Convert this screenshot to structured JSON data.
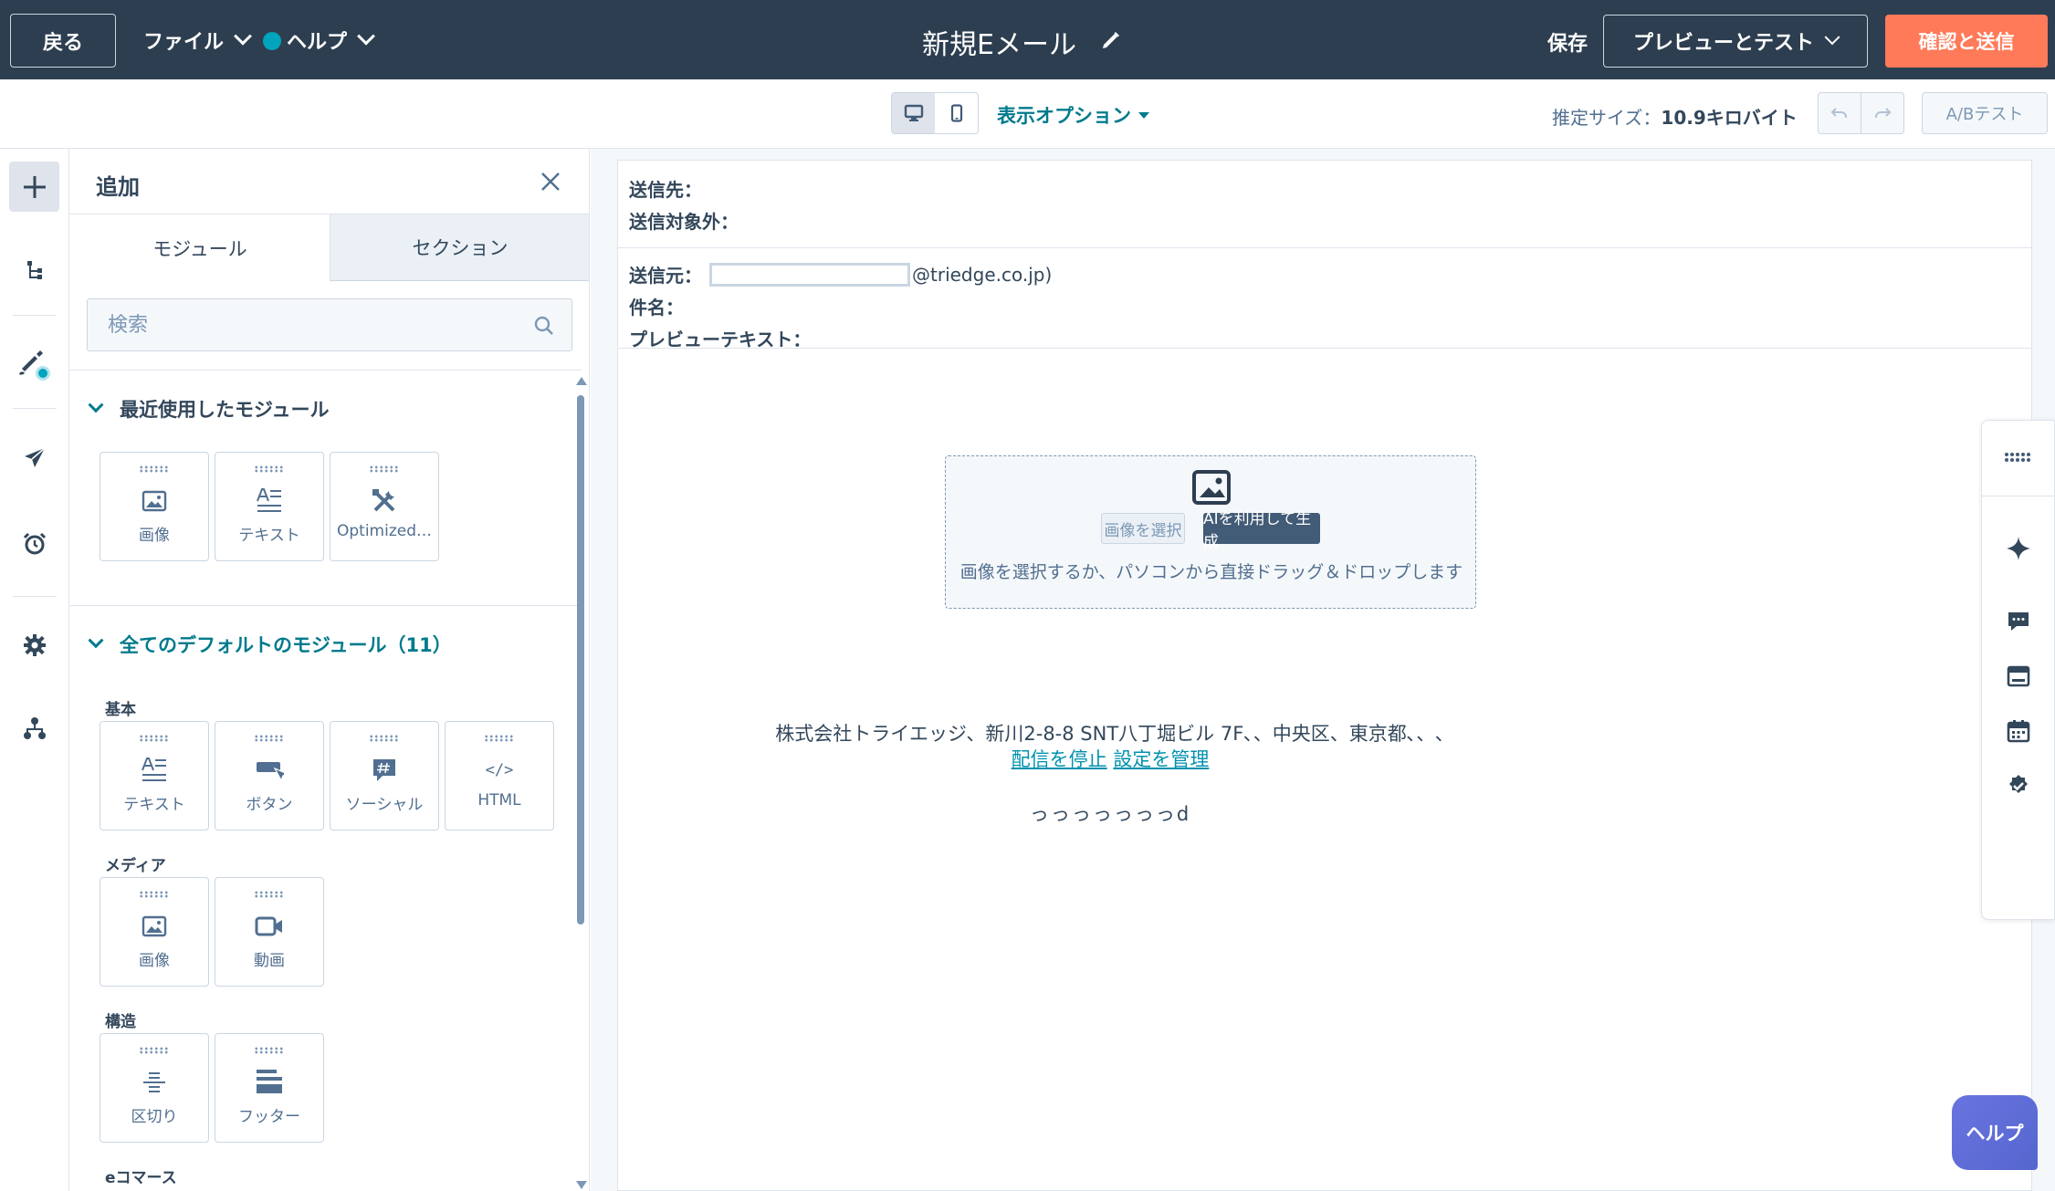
{
  "topbar": {
    "back_label": "戻る",
    "file_label": "ファイル",
    "help_label": "ヘルプ",
    "title": "新規Eメール",
    "save_label": "保存",
    "preview_label": "プレビューとテスト",
    "send_label": "確認と送信"
  },
  "toolbar": {
    "display_options": "表示オプション",
    "est_size_label": "推定サイズ：",
    "est_size_value": "10.9キロバイト",
    "ab_test": "A/Bテスト"
  },
  "panel": {
    "title": "追加",
    "tabs": [
      "モジュール",
      "セクション"
    ],
    "search_placeholder": "検索",
    "recent_header": "最近使用したモジュール",
    "recent_modules": [
      {
        "label": "画像",
        "icon": "image-icon"
      },
      {
        "label": "テキスト",
        "icon": "text-icon"
      },
      {
        "label": "Optimized…",
        "icon": "tools-icon"
      }
    ],
    "all_header": "全てのデフォルトのモジュール（11）",
    "categories": {
      "basic": {
        "label": "基本",
        "modules": [
          {
            "label": "テキスト",
            "icon": "text-icon"
          },
          {
            "label": "ボタン",
            "icon": "button-icon"
          },
          {
            "label": "ソーシャル",
            "icon": "social-icon"
          },
          {
            "label": "HTML",
            "icon": "html-icon"
          }
        ]
      },
      "media": {
        "label": "メディア",
        "modules": [
          {
            "label": "画像",
            "icon": "image-icon"
          },
          {
            "label": "動画",
            "icon": "video-icon"
          }
        ]
      },
      "structure": {
        "label": "構造",
        "modules": [
          {
            "label": "区切り",
            "icon": "divider-icon"
          },
          {
            "label": "フッター",
            "icon": "footer-icon"
          }
        ]
      },
      "ecommerce": {
        "label": "eコマース"
      }
    }
  },
  "email": {
    "to_label": "送信先：",
    "exclude_label": "送信対象外：",
    "from_label": "送信元：",
    "from_domain": "@triedge.co.jp)",
    "subject_label": "件名：",
    "preview_text_label": "プレビューテキスト：",
    "image_block": {
      "select_button": "画像を選択",
      "ai_button": "AIを利用して生成",
      "hint": "画像を選択するか、パソコンから直接ドラッグ＆ドロップします"
    },
    "footer": {
      "address": "株式会社トライエッジ、新川2-8-8 SNT八丁堀ビル 7F､、中央区、東京都､、､",
      "unsubscribe": "配信を停止",
      "manage": "設定を管理",
      "extra_text": "っっっっっっっd"
    }
  },
  "help_fab": "ヘルプ",
  "colors": {
    "topbar_bg": "#2d3e50",
    "accent_orange": "#ff7a59",
    "teal": "#007a8c",
    "link": "#0091ae"
  }
}
